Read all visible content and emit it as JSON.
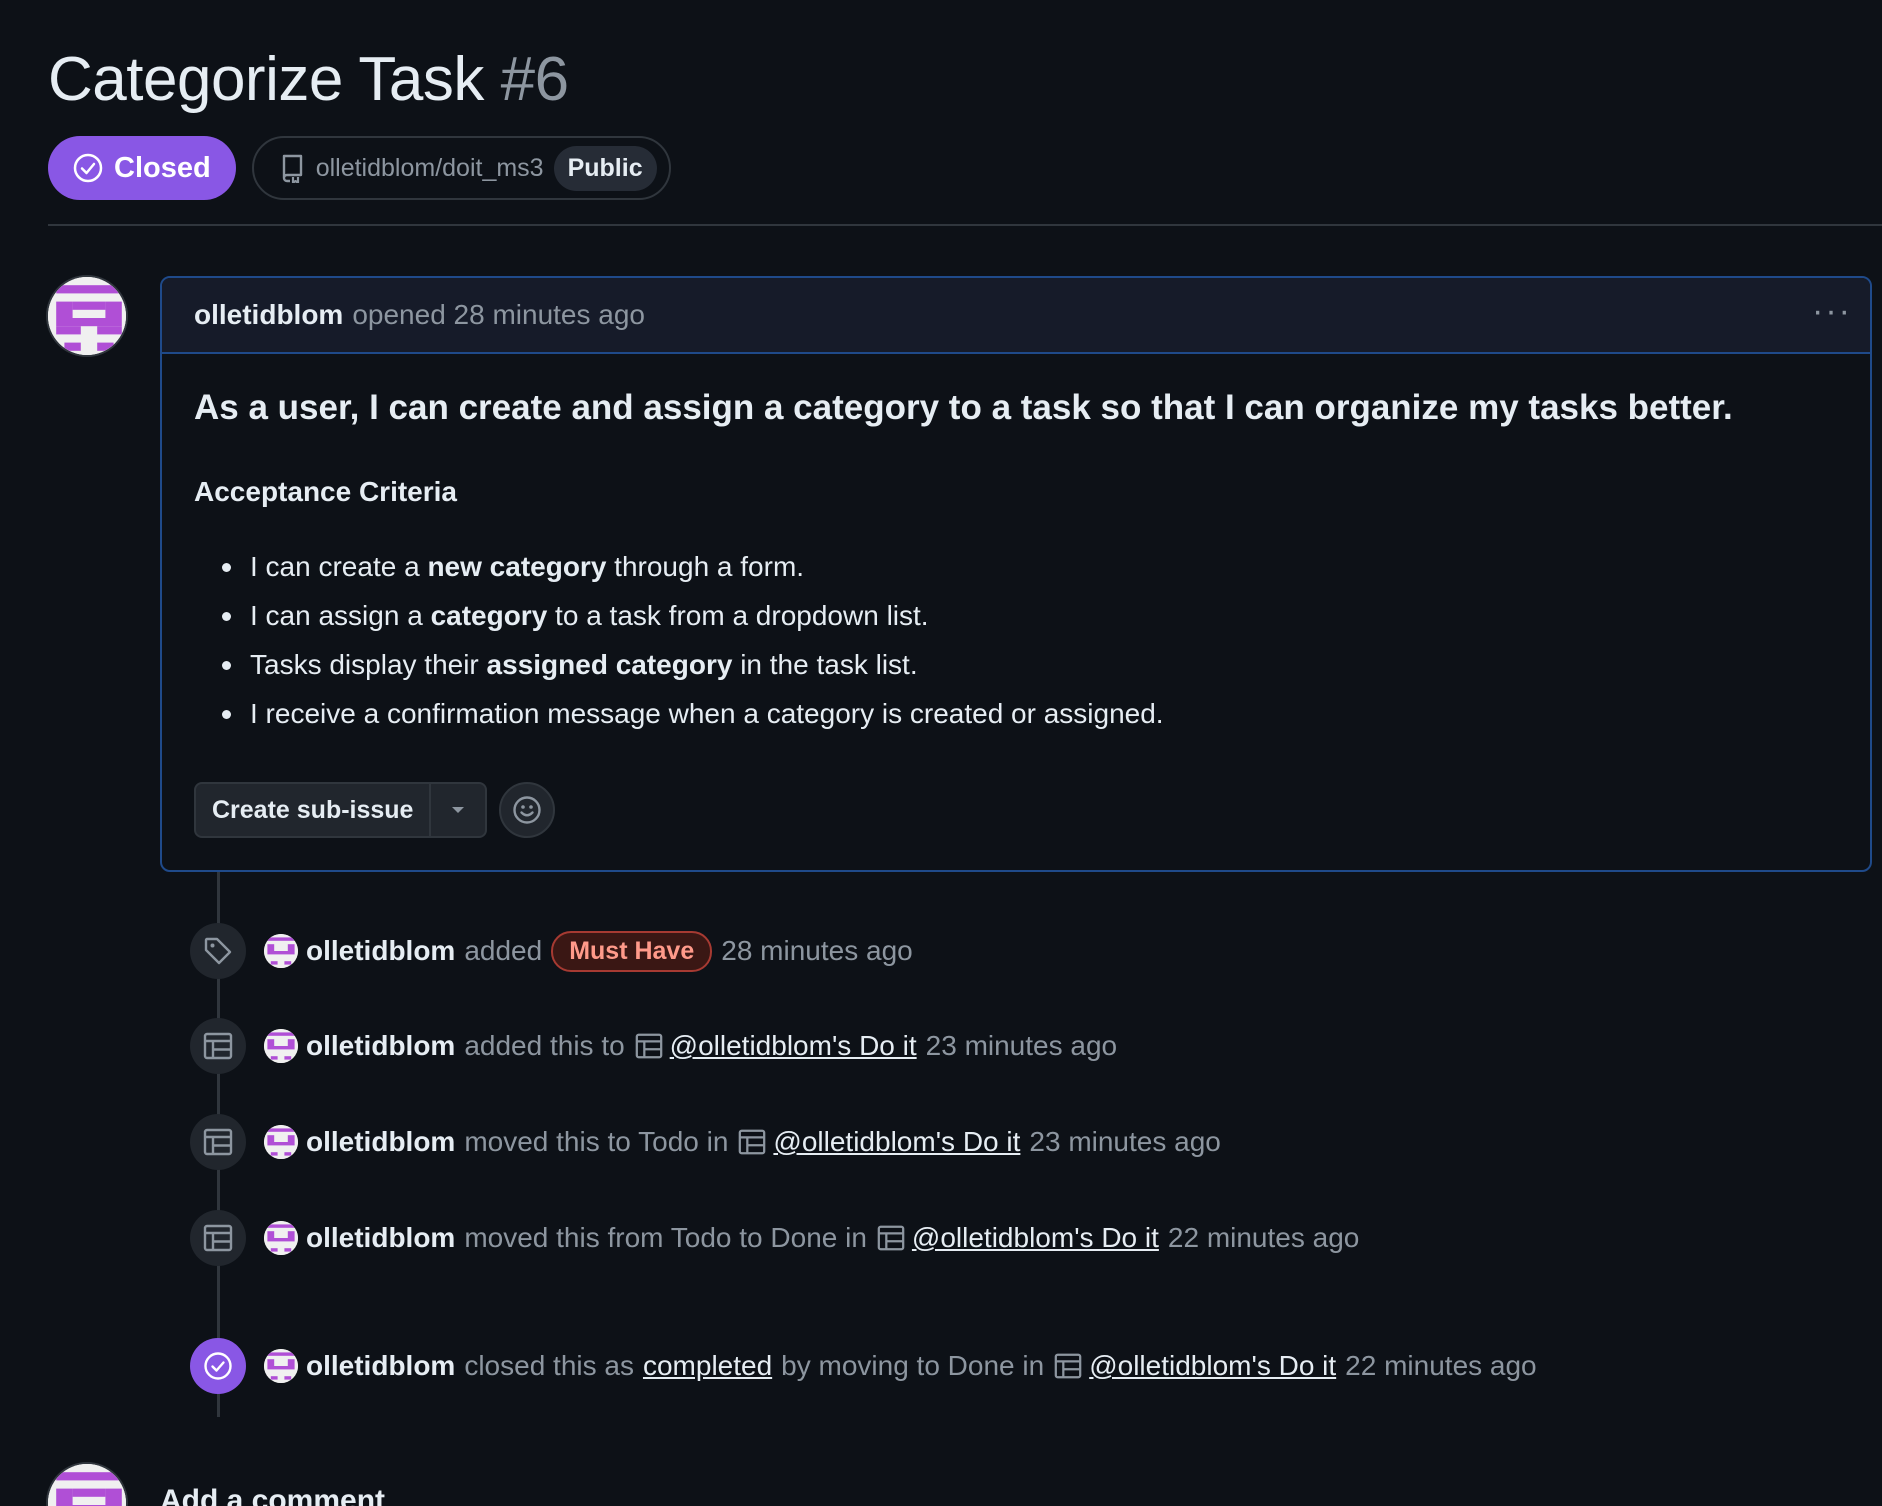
{
  "issue": {
    "title": "Categorize Task",
    "number": "#6",
    "state": "Closed",
    "repo": "olletidblom/doit_ms3",
    "visibility": "Public"
  },
  "comment": {
    "author": "olletidblom",
    "meta": "opened 28 minutes ago",
    "menu": "···",
    "heading": "As a user, I can create and assign a category to a task so that I can organize my tasks better.",
    "subheading": "Acceptance Criteria",
    "criteria": [
      {
        "pre": "I can create a ",
        "bold": "new category",
        "post": " through a form."
      },
      {
        "pre": "I can assign a ",
        "bold": "category",
        "post": " to a task from a dropdown list."
      },
      {
        "pre": "Tasks display their ",
        "bold": "assigned category",
        "post": " in the task list."
      },
      {
        "pre": "I receive a confirmation message when a category is created or assigned.",
        "bold": "",
        "post": ""
      }
    ],
    "create_subissue_label": "Create sub-issue"
  },
  "timeline": [
    {
      "user": "olletidblom",
      "text": "added",
      "label": "Must Have",
      "time": "28 minutes ago"
    },
    {
      "user": "olletidblom",
      "text": "added this to",
      "project": "@olletidblom's Do it",
      "time": "23 minutes ago"
    },
    {
      "user": "olletidblom",
      "text": "moved this to Todo in",
      "project": "@olletidblom's Do it",
      "time": "23 minutes ago"
    },
    {
      "user": "olletidblom",
      "text": "moved this from Todo to Done in",
      "project": "@olletidblom's Do it",
      "time": "22 minutes ago"
    },
    {
      "user": "olletidblom",
      "text": "closed this as",
      "link": "completed",
      "text2": "by moving to Done in",
      "project": "@olletidblom's Do it",
      "time": "22 minutes ago"
    }
  ],
  "add_comment": {
    "title": "Add a comment"
  },
  "colors": {
    "accent": "#8957e5",
    "background": "#0d1117",
    "border": "#30363d",
    "label_red": "#ff9a8a"
  },
  "icons": [
    "check-circle-icon",
    "repo-icon",
    "kebab-icon",
    "tag-icon",
    "project-table-icon",
    "smiley-icon",
    "triangle-down-icon"
  ]
}
